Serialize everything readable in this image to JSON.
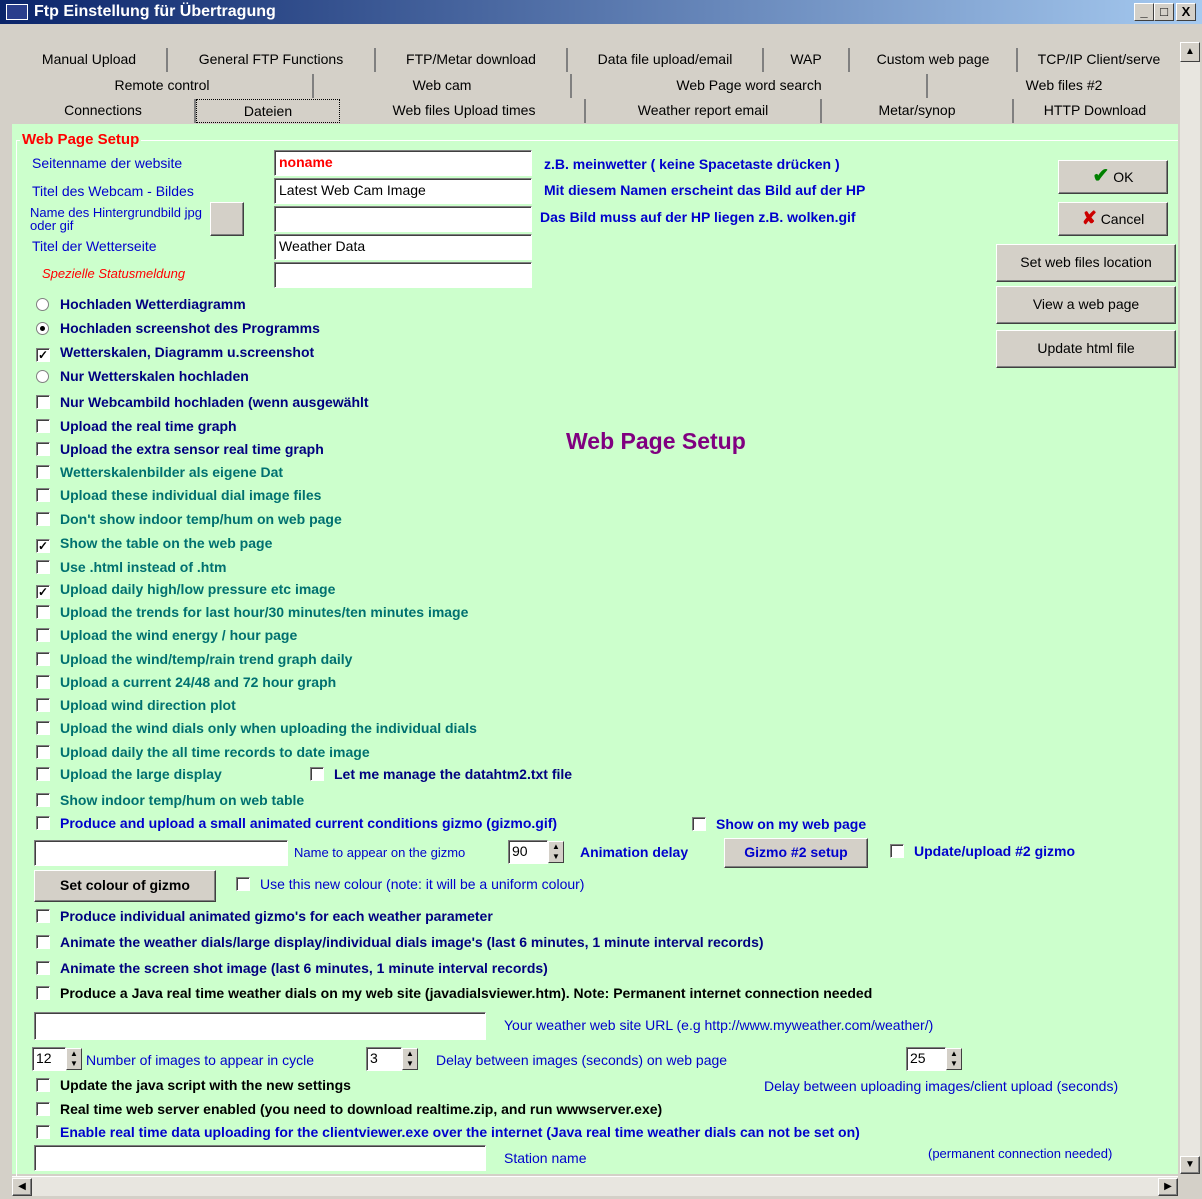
{
  "window": {
    "title": "Ftp Einstellung für Übertragung",
    "min": "_",
    "max": "□",
    "close": "X"
  },
  "tabs": {
    "row1": [
      "Manual Upload",
      "General FTP Functions",
      "FTP/Metar download",
      "Data file upload/email",
      "WAP",
      "Custom web page",
      "TCP/IP Client/serve"
    ],
    "row2": [
      "Remote control",
      "Web cam",
      "Web Page word search",
      "Web files #2"
    ],
    "row3": [
      "Connections",
      "Dateien",
      "Web files Upload times",
      "Weather report email",
      "Metar/synop",
      "HTTP Download"
    ]
  },
  "group_title": "Web Page Setup",
  "fields": {
    "site_name_label": "Seitenname der website",
    "site_name_value": "noname",
    "webcam_title_label": "Titel des Webcam - Bildes",
    "webcam_title_value": "Latest Web Cam Image",
    "bg_image_label": "Name des Hintergrundbild jpg oder gif",
    "bg_image_value": "",
    "weather_title_label": "Titel der Wetterseite",
    "weather_title_value": "Weather Data",
    "status_label": "Spezielle Statusmeldung",
    "status_value": ""
  },
  "hints": {
    "h1": "z.B. meinwetter ( keine Spacetaste drücken )",
    "h2": "Mit diesem Namen erscheint das Bild auf der HP",
    "h3": "Das Bild muss auf der HP liegen z.B. wolken.gif"
  },
  "side_buttons": {
    "ok": "OK",
    "cancel": "Cancel",
    "set_loc": "Set web files location",
    "view": "View a web page",
    "update": "Update html file"
  },
  "heading": "Web Page Setup",
  "options": [
    {
      "label": "Hochladen Wetterdiagramm",
      "kind": "radio",
      "on": false
    },
    {
      "label": "Hochladen screenshot des Programms",
      "kind": "radio",
      "on": true
    },
    {
      "label": "Wetterskalen, Diagramm u.screenshot",
      "kind": "check",
      "on": true
    },
    {
      "label": "Nur Wetterskalen hochladen",
      "kind": "radio",
      "on": false
    },
    {
      "label": "Nur Webcambild hochladen (wenn ausgewählt",
      "kind": "check",
      "on": false
    },
    {
      "label": "Upload the real time graph",
      "kind": "check",
      "on": false
    },
    {
      "label": "Upload the extra sensor real time graph",
      "kind": "check",
      "on": false
    },
    {
      "label": "Wetterskalenbilder als eigene Dat",
      "kind": "check",
      "on": false
    },
    {
      "label": "Upload these individual dial image files",
      "kind": "check",
      "on": false
    },
    {
      "label": "Don't show indoor temp/hum on web page",
      "kind": "check",
      "on": false
    },
    {
      "label": "Show the table on the web page",
      "kind": "check",
      "on": true
    },
    {
      "label": "Use .html instead of .htm",
      "kind": "check",
      "on": false
    },
    {
      "label": "Upload daily high/low pressure etc image",
      "kind": "check",
      "on": true
    },
    {
      "label": "Upload the trends for last hour/30 minutes/ten minutes image",
      "kind": "check",
      "on": false
    },
    {
      "label": "Upload the wind energy / hour page",
      "kind": "check",
      "on": false
    },
    {
      "label": "Upload the wind/temp/rain trend graph daily",
      "kind": "check",
      "on": false
    },
    {
      "label": "Upload a current 24/48 and 72 hour graph",
      "kind": "check",
      "on": false
    },
    {
      "label": "Upload wind direction plot",
      "kind": "check",
      "on": false
    },
    {
      "label": "Upload the wind dials only when uploading the individual dials",
      "kind": "check",
      "on": false
    },
    {
      "label": "Upload daily the all time records to date image",
      "kind": "check",
      "on": false
    },
    {
      "label": "Upload the large display",
      "kind": "check",
      "on": false
    },
    {
      "label": "Show indoor temp/hum on web table",
      "kind": "check",
      "on": false
    },
    {
      "label": "Produce and upload a small animated current conditions gizmo (gizmo.gif)",
      "kind": "check",
      "on": false
    }
  ],
  "manage_datahtm": "Let me manage the datahtm2.txt file",
  "show_on_page": "Show on my web page",
  "gizmo": {
    "name_label": "Name to appear on the gizmo",
    "delay_value": "90",
    "delay_label": "Animation delay",
    "setup_button": "Gizmo #2 setup",
    "update2": "Update/upload #2 gizmo",
    "colour_button": "Set colour of gizmo",
    "use_colour": "Use this new colour (note: it will be a uniform colour)"
  },
  "options2": [
    "Produce individual animated gizmo's for each weather parameter",
    "Animate the weather dials/large display/individual dials image's (last 6 minutes, 1 minute interval records)",
    "Animate the screen shot image (last 6 minutes, 1 minute interval records)",
    "Produce a Java real time weather dials on my web site (javadialsviewer.htm). Note: Permanent internet connection needed"
  ],
  "url_label": "Your weather web site URL (e.g http://www.myweather.com/weather/)",
  "cycle": {
    "images_value": "12",
    "images_label": "Number of images to appear in cycle",
    "delay_value": "3",
    "delay_label": "Delay between images (seconds) on web page",
    "upload_value": "25",
    "upload_label": "Delay between uploading images/client upload (seconds)"
  },
  "options3": [
    "Update the java script with the new settings",
    "Real time web server enabled (you need to download realtime.zip, and run wwwserver.exe)",
    "Enable real time data uploading for the clientviewer.exe over the internet (Java real time weather dials can not be set on)"
  ],
  "station_label": "Station name",
  "permanent_note": "(permanent connection needed)"
}
